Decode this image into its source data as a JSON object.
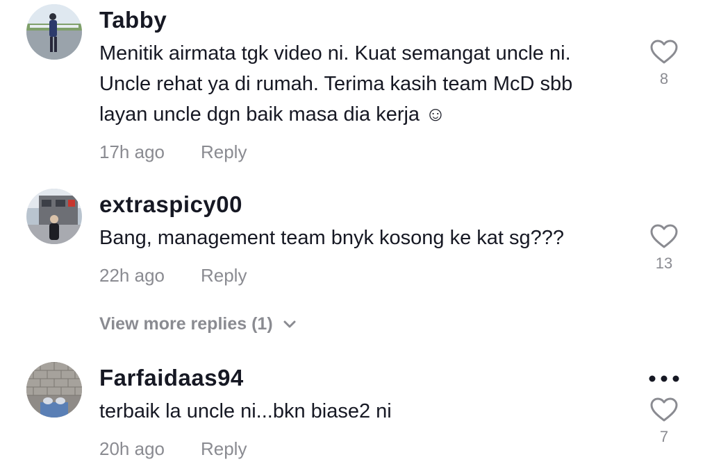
{
  "comments": [
    {
      "username": "Tabby",
      "text_lines": [
        "Menitik airmata tgk video ni. Kuat semangat uncle ni.",
        "Uncle rehat ya di rumah. Terima kasih team McD sbb",
        "layan uncle dgn baik masa dia kerja ☺"
      ],
      "time": "17h ago",
      "reply_label": "Reply",
      "likes": "8"
    },
    {
      "username": "extraspicy00",
      "text_lines": [
        "Bang, management team bnyk kosong ke kat sg???"
      ],
      "time": "22h ago",
      "reply_label": "Reply",
      "likes": "13"
    },
    {
      "username": "Farfaidaas94",
      "text_lines": [
        "terbaik la uncle ni...bkn biase2 ni"
      ],
      "time": "20h ago",
      "reply_label": "Reply",
      "likes": "7"
    }
  ],
  "view_more": "View more replies (1)",
  "icons": {
    "like": "heart-outline-icon",
    "expand": "chevron-down-icon",
    "more": "more-dots-icon"
  },
  "colors": {
    "primary_text": "#161823",
    "secondary_text": "#8a8b91",
    "icon": "#8a8b91"
  }
}
